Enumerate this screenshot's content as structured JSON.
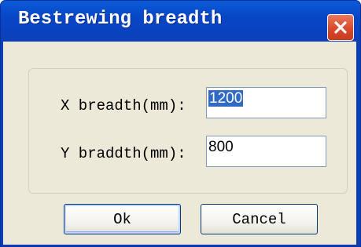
{
  "window": {
    "title": "Bestrewing breadth"
  },
  "form": {
    "x_label": "X breadth(mm):",
    "x_value": "1200",
    "y_label": "Y braddth(mm):",
    "y_value": "800"
  },
  "buttons": {
    "ok_label": "Ok",
    "cancel_label": "Cancel"
  },
  "colors": {
    "titlebar": "#0846c7",
    "close_button": "#d84a2c",
    "client_background": "#ece9d8",
    "selection": "#316ac5"
  },
  "icons": {
    "close": "close-icon"
  }
}
